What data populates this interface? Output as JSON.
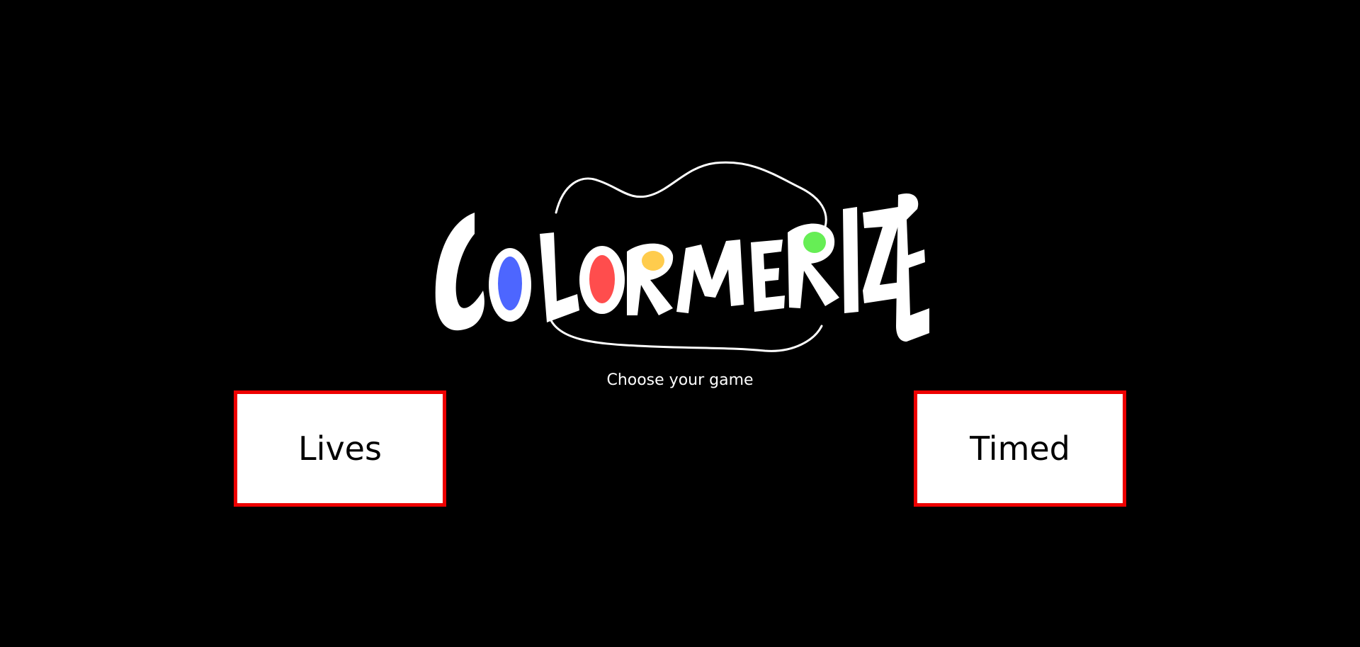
{
  "logo": {
    "letters": [
      "C",
      "O",
      "L",
      "O",
      "R",
      "M",
      "E",
      "R",
      "I",
      "Z",
      "E"
    ],
    "letter_color": "#ffffff",
    "accent_colors": {
      "o_first": "#4d66ff",
      "o_second": "#ff4d4d",
      "r_first": "#ffcc4d",
      "r_second": "#66ee55"
    }
  },
  "subtitle": "Choose your game",
  "modes": {
    "lives_label": "Lives",
    "timed_label": "Timed"
  },
  "colors": {
    "background": "#000000",
    "button_border": "#ee0000",
    "button_fill": "#ffffff"
  }
}
